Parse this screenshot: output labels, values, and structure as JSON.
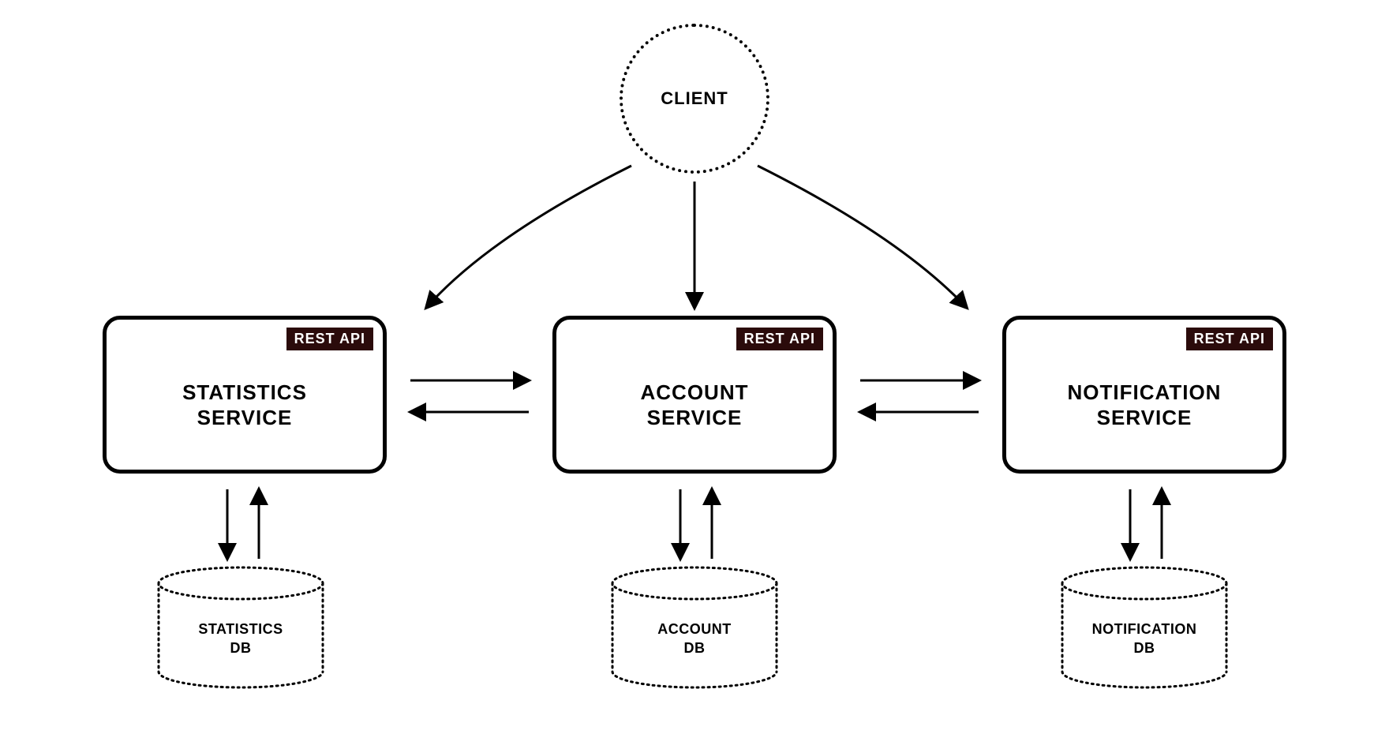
{
  "client": {
    "label": "CLIENT"
  },
  "badge": "REST API",
  "services": {
    "statistics": {
      "line1": "STATISTICS",
      "line2": "SERVICE"
    },
    "account": {
      "line1": "ACCOUNT",
      "line2": "SERVICE"
    },
    "notification": {
      "line1": "NOTIFICATION",
      "line2": "SERVICE"
    }
  },
  "databases": {
    "statistics": {
      "line1": "STATISTICS",
      "line2": "DB"
    },
    "account": {
      "line1": "ACCOUNT",
      "line2": "DB"
    },
    "notification": {
      "line1": "NOTIFICATION",
      "line2": "DB"
    }
  }
}
